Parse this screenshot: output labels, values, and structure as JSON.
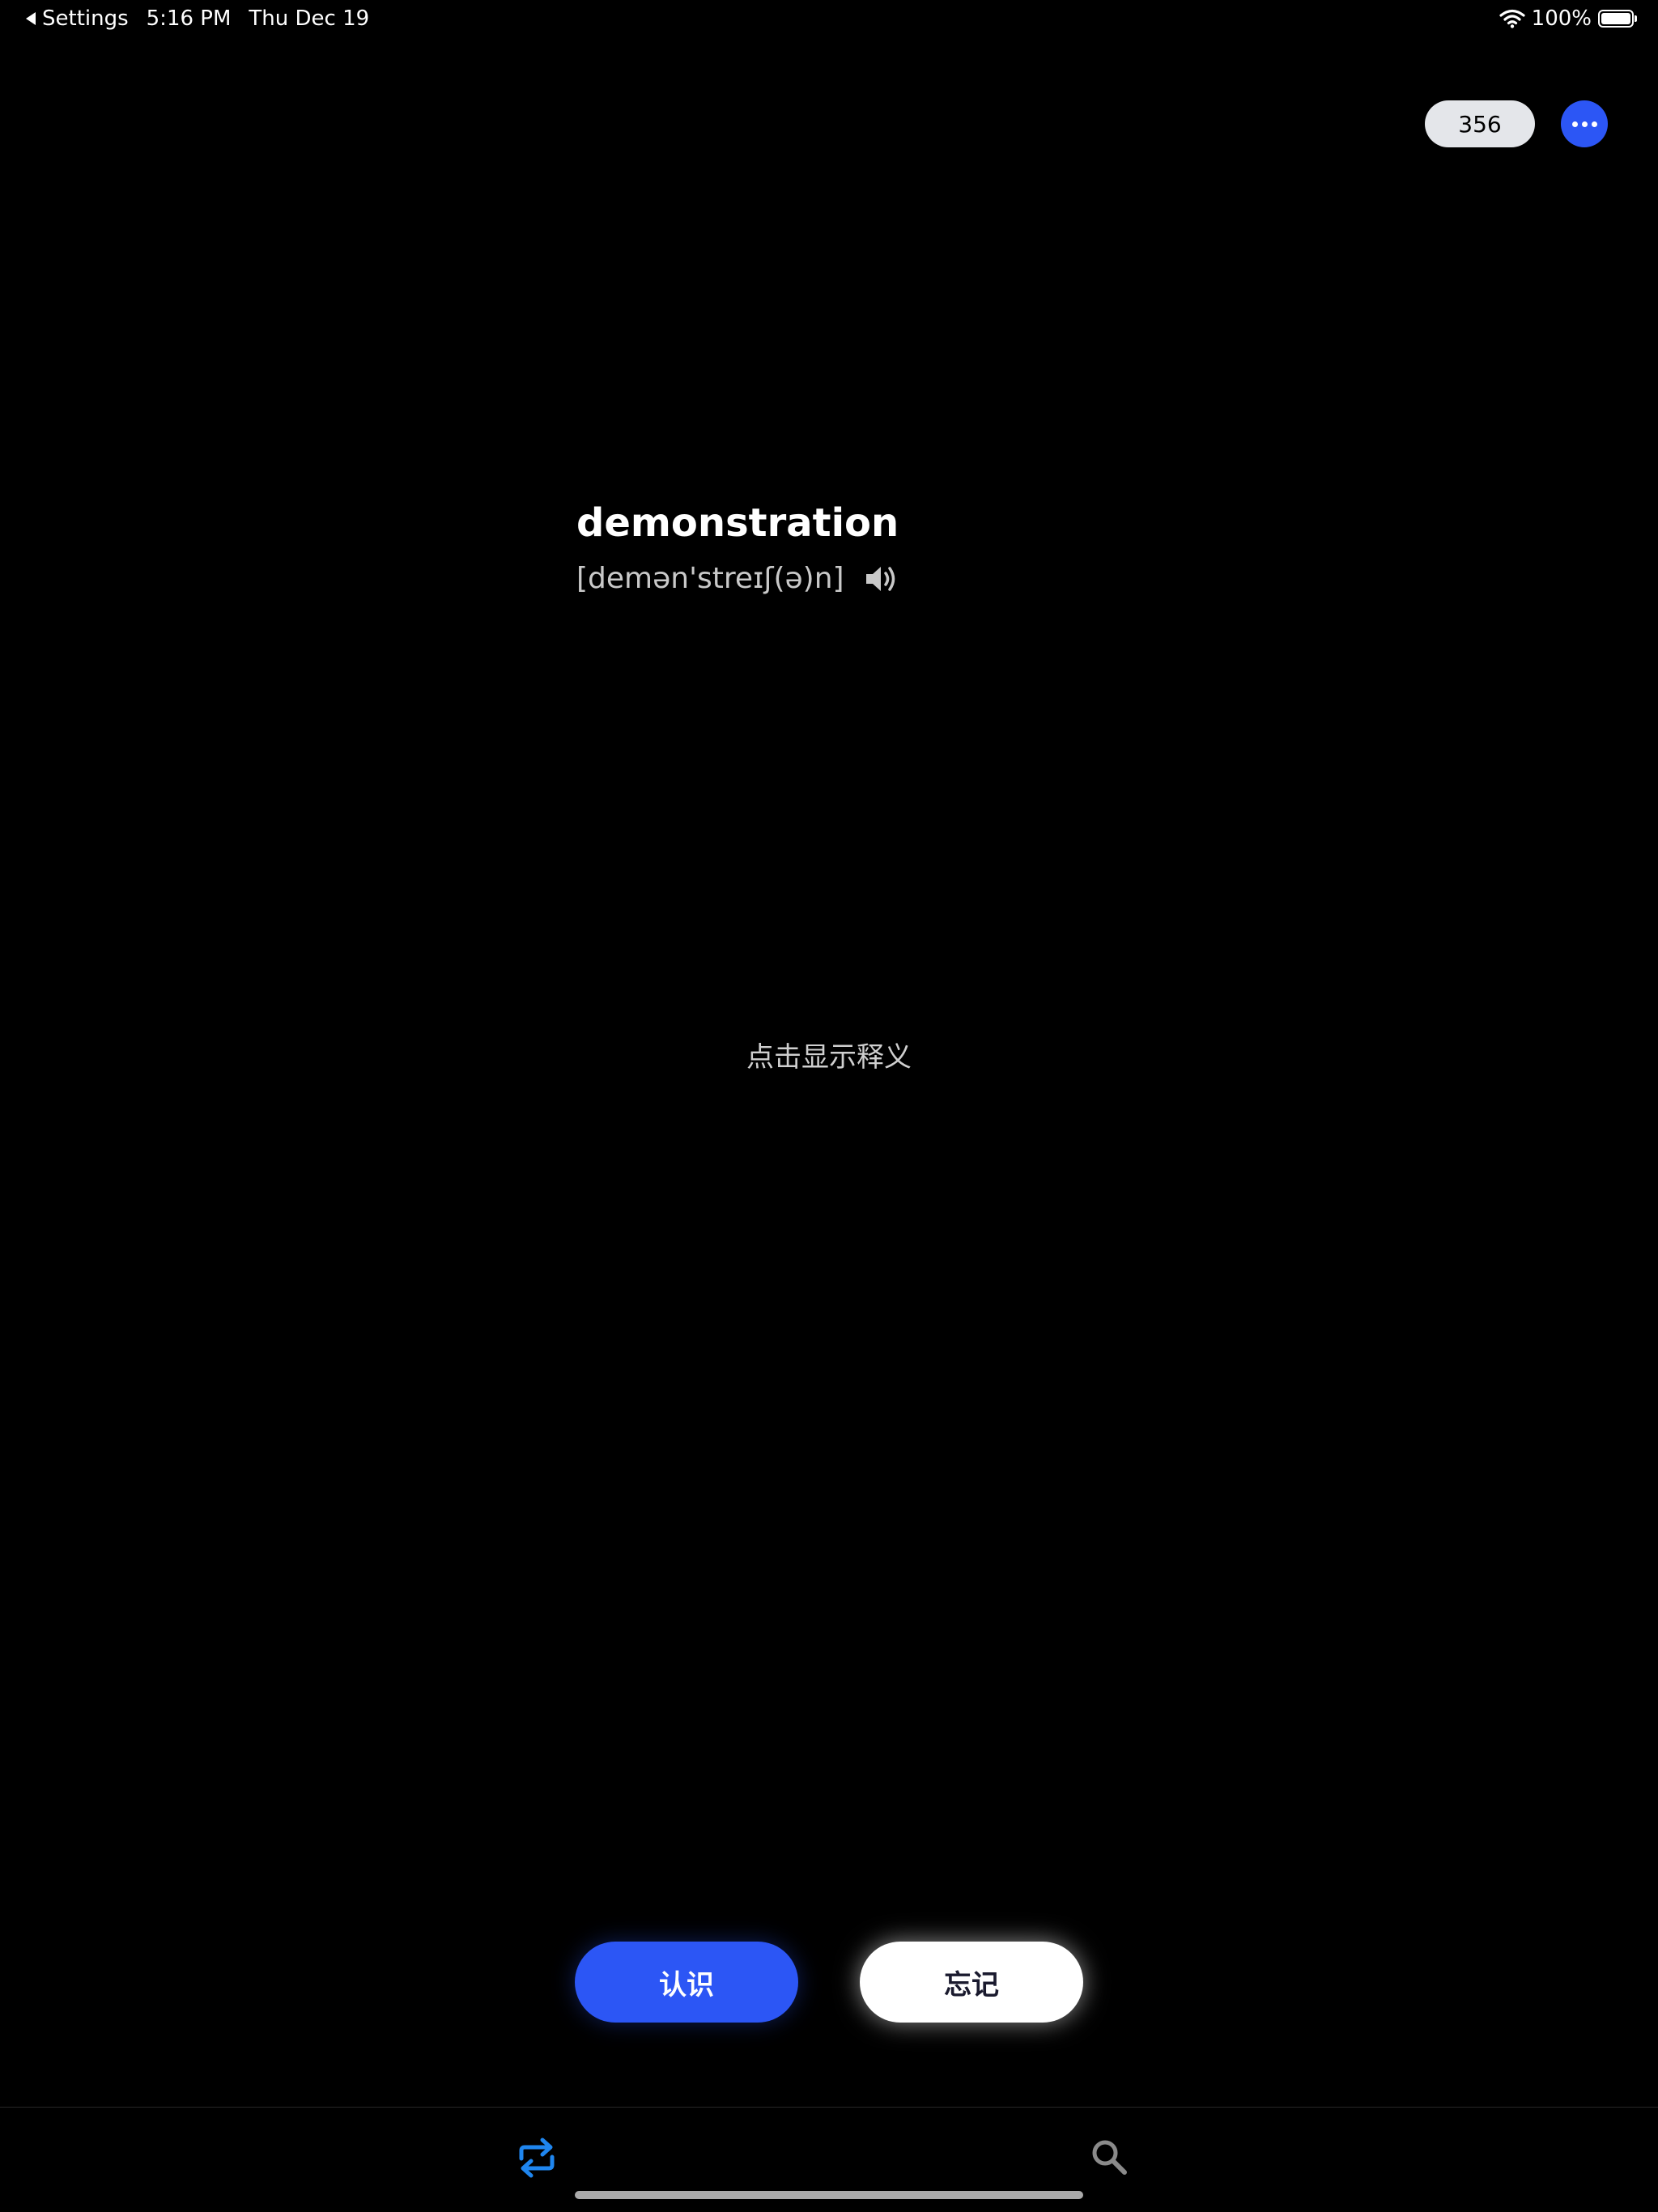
{
  "status_bar": {
    "back_label": "Settings",
    "time": "5:16 PM",
    "date": "Thu Dec 19",
    "battery_percent": "100%",
    "battery_level": 1.0
  },
  "header": {
    "count": "356",
    "more_icon": "more-dots-icon"
  },
  "card": {
    "word": "demonstration",
    "phonetic": "[demən'streɪʃ(ə)n]",
    "speaker_icon": "speaker-icon",
    "hint": "点击显示释义"
  },
  "actions": {
    "know_label": "认识",
    "forget_label": "忘记"
  },
  "tab_bar": {
    "review_icon": "repeat-icon",
    "search_icon": "search-icon"
  },
  "colors": {
    "background": "#000000",
    "accent": "#2c56f5",
    "badge": "#e4e6ea",
    "tab_active": "#1f86ef",
    "tab_inactive": "#8a8a8a"
  }
}
